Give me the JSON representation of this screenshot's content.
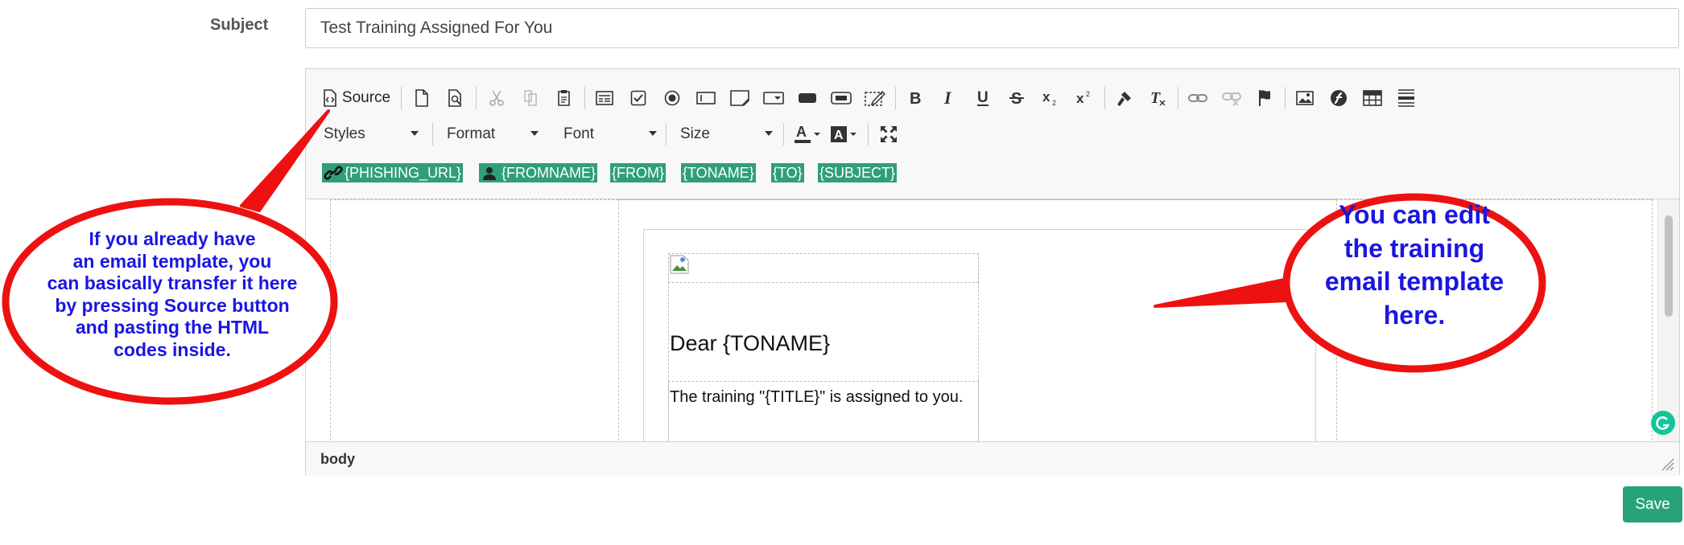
{
  "form": {
    "subject_label": "Subject",
    "subject_value": "Test Training Assigned For You",
    "save_label": "Save"
  },
  "toolbar": {
    "source_label": "Source",
    "icons_row1": [
      "source-icon",
      "new-page-icon",
      "preview-icon",
      "cut-icon",
      "copy-icon",
      "paste-icon",
      "form-icon",
      "checkbox-icon",
      "radio-icon",
      "text-field-icon",
      "textarea-icon",
      "select-icon",
      "button-icon",
      "image-button-icon",
      "hidden-field-icon",
      "bold-icon",
      "italic-icon",
      "underline-icon",
      "strikethrough-icon",
      "subscript-icon",
      "superscript-icon",
      "copy-formatting-icon",
      "remove-format-icon",
      "link-icon",
      "unlink-icon",
      "anchor-icon",
      "image-icon",
      "flash-icon",
      "table-icon",
      "horizontal-line-icon"
    ],
    "styles_label": "Styles",
    "format_label": "Format",
    "font_label": "Font",
    "size_label": "Size",
    "icons_row2": [
      "text-color-icon",
      "background-color-icon",
      "maximize-icon"
    ],
    "placeholders": [
      "{PHISHING_URL}",
      "{FROMNAME}",
      "{FROM}",
      "{TONAME}",
      "{TO}",
      "{SUBJECT}"
    ]
  },
  "email": {
    "greeting": "Dear {TONAME}",
    "body": "The training \"{TITLE}\" is assigned to you."
  },
  "statusbar": {
    "path": "body"
  },
  "annotations": {
    "left_callout": [
      "If you already have",
      "an email template, you",
      "can basically transfer it here",
      "by pressing Source button",
      "and pasting the HTML",
      "codes inside."
    ],
    "right_callout": [
      "You can edit",
      "the training",
      "email template",
      "here."
    ]
  },
  "colors": {
    "accent_green": "#2f9e7b",
    "save_green": "#26a37a",
    "callout_red": "#ee1111",
    "callout_text": "#1a16e0",
    "grammarly_green": "#15c39a"
  }
}
